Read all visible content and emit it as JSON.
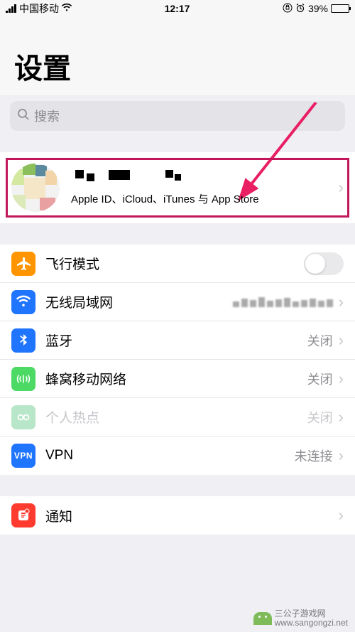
{
  "status_bar": {
    "carrier": "中国移动",
    "time": "12:17",
    "battery_percent": "39%"
  },
  "header": {
    "title": "设置"
  },
  "search": {
    "placeholder": "搜索"
  },
  "account": {
    "subtitle": "Apple ID、iCloud、iTunes 与 App Store"
  },
  "rows": {
    "airplane": {
      "label": "飞行模式",
      "icon_color": "#ff9500"
    },
    "wifi": {
      "label": "无线局域网",
      "icon_color": "#1f75fe"
    },
    "bluetooth": {
      "label": "蓝牙",
      "value": "关闭",
      "icon_color": "#1f75fe"
    },
    "cellular": {
      "label": "蜂窝移动网络",
      "value": "关闭",
      "icon_color": "#4cd964"
    },
    "hotspot": {
      "label": "个人热点",
      "value": "关闭",
      "icon_color": "#b8e6c8"
    },
    "vpn": {
      "label": "VPN",
      "value": "未连接",
      "badge": "VPN"
    },
    "notifications": {
      "label": "通知",
      "icon_color": "#ff3b30"
    }
  },
  "watermark": {
    "name": "三公子游戏网",
    "url": "www.sangongzi.net"
  }
}
